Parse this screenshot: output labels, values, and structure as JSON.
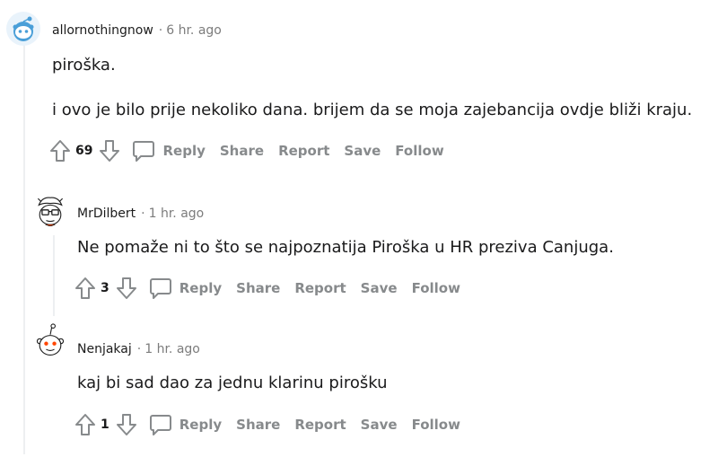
{
  "comments": [
    {
      "username": "allornothingnow",
      "separator": "·",
      "timestamp": "6 hr. ago",
      "avatar": "snoo-avatar-blue",
      "lines": [
        "piroška.",
        "i ovo je bilo prije nekoliko dana. brijem da se moja zajebancija ovdje bliži kraju."
      ],
      "score": "69"
    },
    {
      "username": "MrDilbert",
      "separator": "·",
      "timestamp": "1 hr. ago",
      "avatar": "snoo-avatar-glasses",
      "lines": [
        "Ne pomaže ni to što se najpoznatija Piroška u HR preziva Canjuga."
      ],
      "score": "3"
    },
    {
      "username": "Nenjakaj",
      "separator": "·",
      "timestamp": "1 hr. ago",
      "avatar": "snoo-avatar-default",
      "lines": [
        "kaj bi sad dao za jednu klarinu pirošku"
      ],
      "score": "1"
    }
  ],
  "actions": {
    "reply": "Reply",
    "share": "Share",
    "report": "Report",
    "save": "Save",
    "follow": "Follow"
  },
  "colors": {
    "muted_text": "#878a8c",
    "thread_line": "#edeff1",
    "avatar_blue": "#4a9fd8"
  }
}
